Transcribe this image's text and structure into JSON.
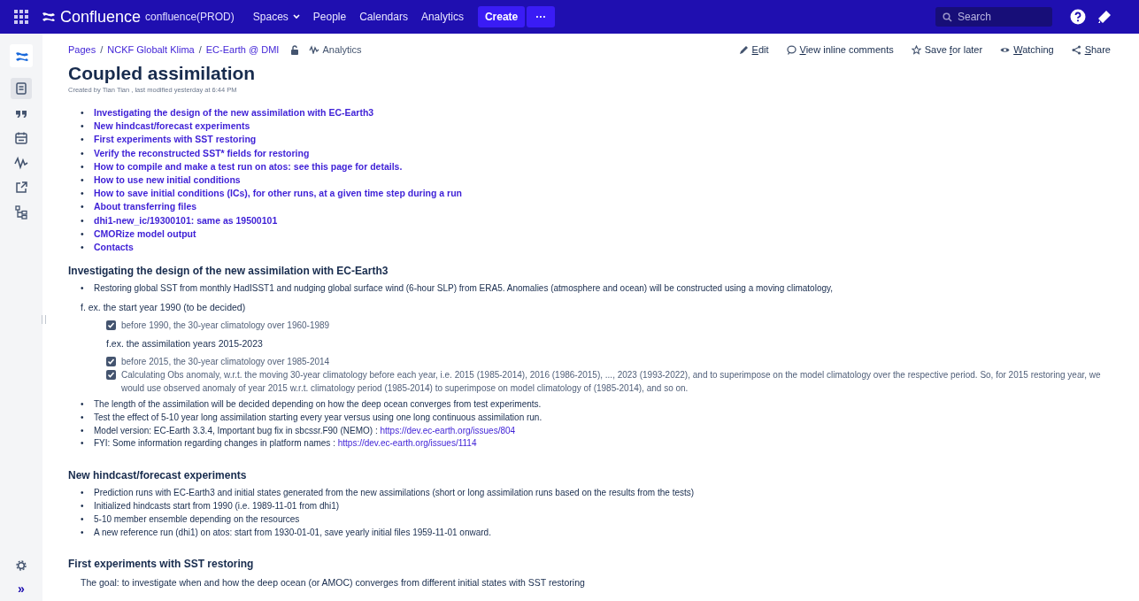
{
  "topbar": {
    "logo": "Confluence",
    "instance": "confluence(PROD)",
    "nav": [
      {
        "label": "Spaces",
        "dropdown": true
      },
      {
        "label": "People",
        "dropdown": false
      },
      {
        "label": "Calendars",
        "dropdown": false
      },
      {
        "label": "Analytics",
        "dropdown": false
      }
    ],
    "create": "Create",
    "more": "···",
    "search": {
      "placeholder": "Search"
    }
  },
  "sidebar": {
    "items": [
      {
        "kind": "page",
        "selected": true
      },
      {
        "kind": "quote",
        "selected": false
      },
      {
        "kind": "calendar",
        "selected": false
      },
      {
        "kind": "analytics",
        "selected": false
      },
      {
        "kind": "external",
        "selected": false
      },
      {
        "kind": "tree",
        "selected": false
      }
    ],
    "bottom": [
      {
        "kind": "settings"
      },
      {
        "kind": "expand",
        "label": "»"
      }
    ]
  },
  "breadcrumbs": [
    "Pages",
    "NCKF Globalt Klima",
    "EC-Earth @ DMI"
  ],
  "breadcrumb_separator": "/",
  "bullet": "•",
  "analytics": "Analytics",
  "actions": [
    {
      "kind": "edit",
      "key": "E",
      "after": "dit"
    },
    {
      "kind": "comments",
      "key": "V",
      "after": "iew inline comments"
    },
    {
      "kind": "star",
      "before": "Save ",
      "key": "f",
      "after": "or later"
    },
    {
      "kind": "eye",
      "key": "W",
      "after": "atching"
    },
    {
      "kind": "share",
      "key": "S",
      "after": "hare"
    }
  ],
  "title": "Coupled assimilation",
  "byline": "Created by Tian Tian , last modified yesterday at 6:44 PM",
  "blocks": [
    {
      "kind": "toc",
      "items": [
        "Investigating the design of the new assimilation with EC-Earth3",
        "New hindcast/forecast experiments",
        "First experiments with SST restoring",
        "Verify the reconstructed SST* fields for restoring",
        "How to compile and make a test run on atos: see this page for details.",
        "How to use new initial conditions",
        "How to save initial conditions (ICs), for other runs, at a given time step during a run",
        "About transferring files",
        "dhi1-new_ic/19300101: same as 19500101",
        "CMORize model output",
        "Contacts"
      ]
    },
    {
      "kind": "heading",
      "text": "Investigating the design of the new assimilation with EC-Earth3"
    },
    {
      "kind": "bullets",
      "items": [
        {
          "text": "Restoring global SST from monthly HadISST1 and nudging global surface wind (6-hour SLP) from ERA5. Anomalies (atmosphere and ocean) will be constructed using a moving climatology,"
        }
      ]
    },
    {
      "kind": "para",
      "text": "f. ex. the start year 1990 (to be decided)"
    },
    {
      "kind": "tasks",
      "items": [
        {
          "text": "before 1990,  the 30-year climatology over 1960-1989",
          "checked": true
        }
      ]
    },
    {
      "kind": "subpara",
      "text": "f.ex. the assimilation years 2015-2023"
    },
    {
      "kind": "tasks",
      "items": [
        {
          "text": "before 2015, the 30-year climatology over 1985-2014",
          "checked": true
        },
        {
          "text": "Calculating Obs anomaly, w.r.t. the moving 30-year climatology before each year, i.e. 2015 (1985-2014), 2016 (1986-2015), ..., 2023 (1993-2022), and to superimpose on the model climatology over the respective period. So, for 2015 restoring year, we would use observed anomaly of year 2015 w.r.t. climatology period (1985-2014) to superimpose on model climatology of (1985-2014), and so on.",
          "checked": true
        }
      ]
    },
    {
      "kind": "bullets",
      "items": [
        {
          "text": "The length of the assimilation will be decided depending on how the deep ocean converges from test experiments."
        },
        {
          "text": "Test the effect of 5-10 year long assimilation starting every year versus using one long continuous assimilation run."
        },
        {
          "text": "Model version: EC-Earth 3.3.4, Important bug fix in sbcssr.F90 (NEMO) : ",
          "link": "https://dev.ec-earth.org/issues/804"
        },
        {
          "text": "FYI: Some information regarding changes in platform names : ",
          "link": "https://dev.ec-earth.org/issues/1114"
        }
      ]
    },
    {
      "kind": "heading",
      "text": "New hindcast/forecast experiments"
    },
    {
      "kind": "bullets",
      "items": [
        {
          "text": "Prediction runs with EC-Earth3 and initial states generated from the new assimilations (short or long assimilation runs based on the results from the tests)"
        },
        {
          "text": "Initialized hindcasts start from 1990 (i.e.  1989-11-01 from dhi1)"
        },
        {
          "text": "5-10 member ensemble depending on the resources"
        },
        {
          "text": "A new reference run (dhi1) on atos: start from 1930-01-01, save yearly initial files 1959-11-01 onward."
        }
      ]
    },
    {
      "kind": "heading",
      "text": "First experiments with SST restoring"
    },
    {
      "kind": "para",
      "text": "The goal: to investigate when and how the deep ocean (or AMOC) converges from different initial states with SST restoring"
    }
  ]
}
